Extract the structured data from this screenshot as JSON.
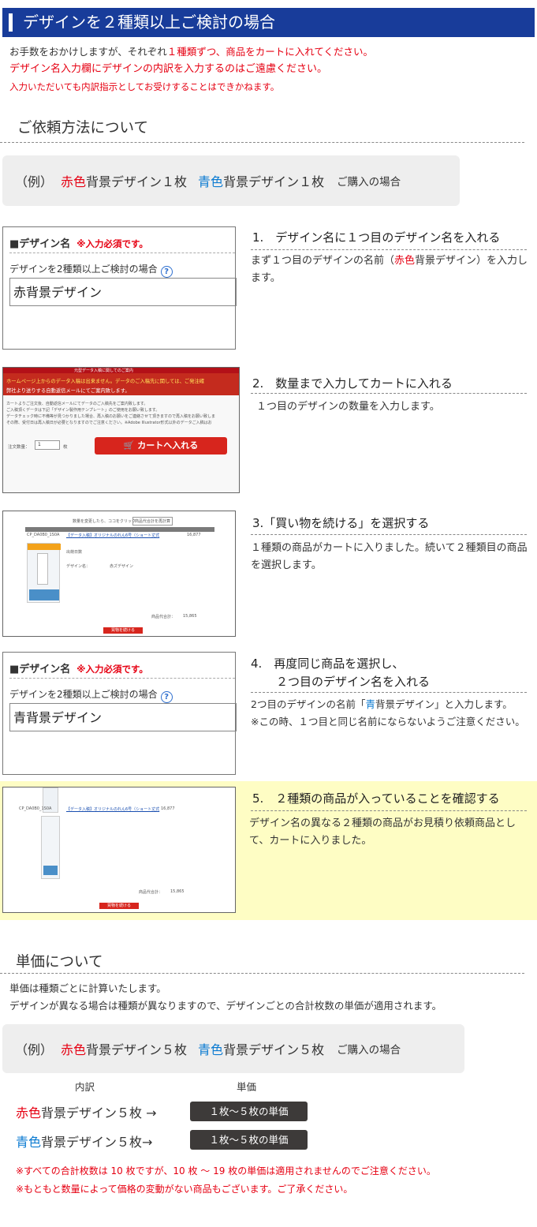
{
  "header": {
    "title": "デザインを２種類以上ご検討の場合"
  },
  "intro": {
    "line1_a": "お手数をおかけしますが、それぞれ",
    "line1_b": "１種類ずつ、商品をカートに入れてください。",
    "line2": "デザイン名入力欄にデザインの内訳を入力するのはご遠慮ください。",
    "line3": "入力いただいても内訳指示としてお受けすることはできかねます。"
  },
  "section1": {
    "title": "ご依頼方法について"
  },
  "example1": {
    "prefix": "（例）",
    "red_word": "赤色",
    "red_rest": "背景デザイン１枚",
    "blue_word": "青色",
    "blue_rest": "背景デザイン１枚",
    "suffix": "ご購入の場合"
  },
  "form1": {
    "label": "■デザイン名",
    "required": "※入力必須です。",
    "sublabel": "デザインを2種類以上ご検討の場合",
    "help": "?",
    "value": "赤背景デザイン"
  },
  "step1": {
    "title": "1.　デザイン名に１つ目のデザイン名を入れる",
    "text_a": "まず１つ目のデザインの名前（",
    "text_red": "赤色",
    "text_b": "背景デザイン）を入力します。"
  },
  "shot2": {
    "banner": "元型データ入稿に関してのご案内",
    "warn1": "ホームページ上からのデータ入稿は出来ません。データのご入稿先に関しては、ご発注確",
    "warn2": "弊社より送りする自動返信メールにてご案内致します。",
    "body1": "カートよりご注文後、自動返信メールにてデータのご入稿先をご案内致します。",
    "body2": "ご入稿頂くデータは下記「デザイン製作用テンプレート」のご使用をお願い致します。",
    "body3": "データチェック時に不備等が見つかりました場合、再入稿のお願いをご連絡させて頂きますので再入稿をお願い致しま",
    "body4": "その際、受付日は再入稿日が必要となりますのでご注意ください。※Adobe Illustrator形式以外のデータご入稿はお",
    "qty_label": "注文数量：",
    "qty_value": "1",
    "qty_unit": "枚",
    "cart_button": "カートへ入れる"
  },
  "step2": {
    "title": "2.　数量まで入力してカートに入れる",
    "text": "１つ目のデザインの数量を入力します。"
  },
  "shot3": {
    "top": "数量を変更したら、ココをクリック",
    "top_btn": "商品代合計を再計算",
    "code": "CP_DA0B0_1S0A",
    "item": "【データ入稿】オリジナルのれん6号（ショート丈式",
    "price": "16,877",
    "row1": "出荷日数",
    "row2": "デザイン名：",
    "row3": "赤ズデザイン",
    "total_label": "商品代合計：",
    "total_value": "15,865",
    "continue_btn": "買物を続ける"
  },
  "step3": {
    "title": "3.「買い物を続ける」を選択する",
    "text": "１種類の商品がカートに入りました。続いて２種類目の商品を選択します。"
  },
  "form2": {
    "label": "■デザイン名",
    "required": "※入力必須です。",
    "sublabel": "デザインを2種類以上ご検討の場合",
    "help": "?",
    "value": "青背景デザイン"
  },
  "step4": {
    "title_line1": "4.　再度同じ商品を選択し、",
    "title_line2": "２つ目のデザイン名を入れる",
    "text_a": "2つ目のデザインの名前「",
    "text_blue": "青",
    "text_b": "背景デザイン」と入力します。",
    "note": "※この時、１つ目と同じ名前にならないようご注意ください。"
  },
  "step5": {
    "title": "5.　２種類の商品が入っていることを確認する",
    "text": "デザイン名の異なる２種類の商品がお見積り依頼商品として、カートに入りました。"
  },
  "shot5": {
    "code": "CP_DA0B0_1S0A",
    "item": "【データ入稿】オリジナルのれん6号（ショート丈式",
    "price": "16,877",
    "total_label": "商品代合計：",
    "total_value": "15,865",
    "continue_btn": "買物を続ける"
  },
  "section2": {
    "title": "単価について"
  },
  "unit": {
    "line1": "単価は種類ごとに計算いたします。",
    "line2": "デザインが異なる場合は種類が異なりますので、デザインごとの合計枚数の単価が適用されます。"
  },
  "example2": {
    "prefix": "（例）",
    "red_word": "赤色",
    "red_rest": "背景デザイン５枚",
    "blue_word": "青色",
    "blue_rest": "背景デザイン５枚",
    "suffix": "ご購入の場合"
  },
  "breakdown": {
    "col1": "内訳",
    "col2": "単価",
    "rows": [
      {
        "color_word": "赤色",
        "rest": "背景デザイン５枚 →",
        "tag": "１枚〜５枚の単価"
      },
      {
        "color_word": "青色",
        "rest": "背景デザイン５枚→",
        "tag": "１枚〜５枚の単価"
      }
    ]
  },
  "notes": {
    "n1": "※すべての合計枚数は 10 枚ですが、10 枚 〜 19 枚の単価は適用されませんのでご注意ください。",
    "n2": "※もともと数量によって価格の変動がない商品もございます。ご了承ください。"
  },
  "colors": {
    "header": "#183c9a",
    "red": "#e60012",
    "blue": "#0a7ad1",
    "yellow_bg": "#fefdc4",
    "tag_bg": "#3d3a39"
  }
}
